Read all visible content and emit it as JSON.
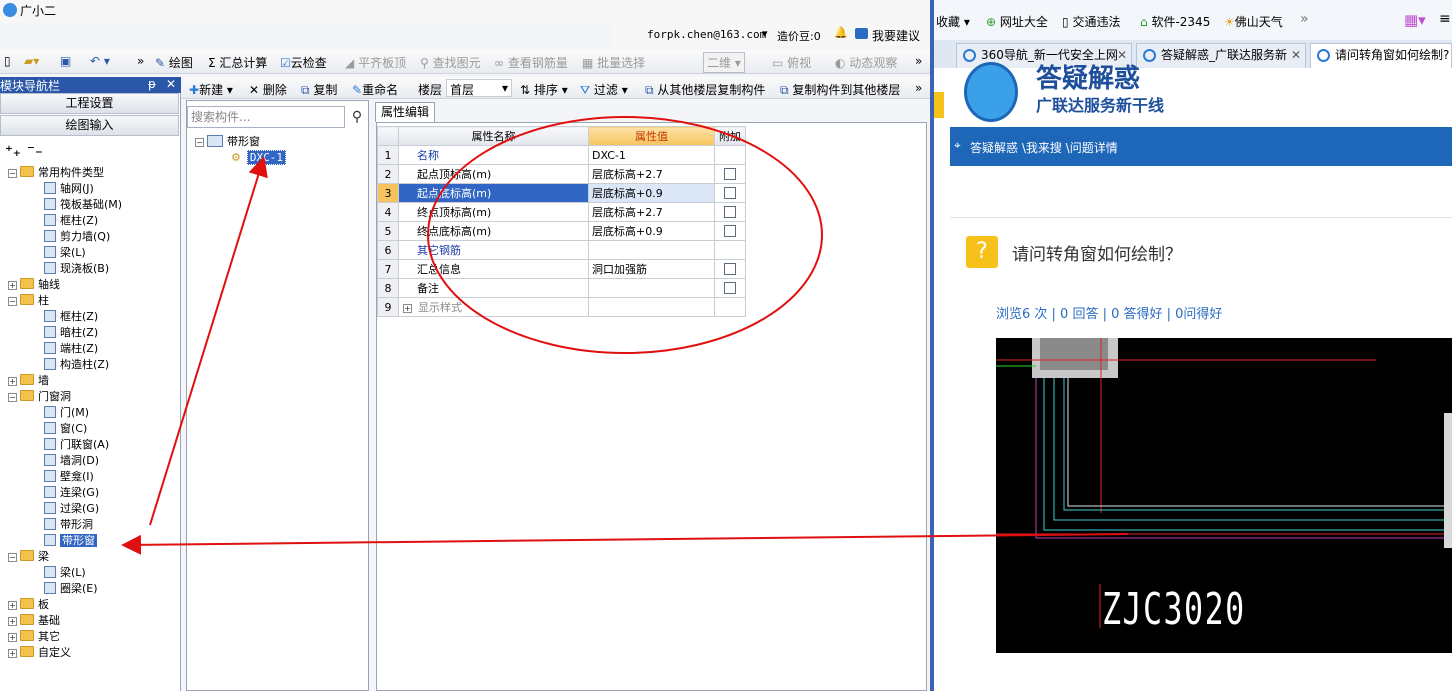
{
  "app": {
    "title": "广小二",
    "account": "forpk.chen@163.com",
    "price_beans": "造价豆:0",
    "suggest": "我要建议",
    "toolbar1": [
      {
        "label": "绘图",
        "enabled": true
      },
      {
        "label": "汇总计算",
        "enabled": true
      },
      {
        "label": "云检查",
        "enabled": true
      },
      {
        "label": "平齐板顶",
        "enabled": false
      },
      {
        "label": "查找图元",
        "enabled": false
      },
      {
        "label": "查看钢筋量",
        "enabled": false
      },
      {
        "label": "批量选择",
        "enabled": false
      },
      {
        "label": "二维",
        "enabled": false
      },
      {
        "label": "俯视",
        "enabled": false
      },
      {
        "label": "动态观察",
        "enabled": false
      }
    ],
    "nav": {
      "header": "模块导航栏",
      "pin": "ᵽ",
      "close": "✕",
      "buttons": [
        "工程设置",
        "绘图输入"
      ],
      "tree": [
        {
          "label": "常用构件类型",
          "level": 0,
          "type": "folder",
          "expanded": true
        },
        {
          "label": "轴网(J)",
          "level": 1,
          "type": "item"
        },
        {
          "label": "筏板基础(M)",
          "level": 1,
          "type": "item"
        },
        {
          "label": "框柱(Z)",
          "level": 1,
          "type": "item"
        },
        {
          "label": "剪力墙(Q)",
          "level": 1,
          "type": "item"
        },
        {
          "label": "梁(L)",
          "level": 1,
          "type": "item"
        },
        {
          "label": "现浇板(B)",
          "level": 1,
          "type": "item"
        },
        {
          "label": "轴线",
          "level": 0,
          "type": "folder",
          "expanded": false
        },
        {
          "label": "柱",
          "level": 0,
          "type": "folder",
          "expanded": true
        },
        {
          "label": "框柱(Z)",
          "level": 1,
          "type": "item"
        },
        {
          "label": "暗柱(Z)",
          "level": 1,
          "type": "item"
        },
        {
          "label": "端柱(Z)",
          "level": 1,
          "type": "item"
        },
        {
          "label": "构造柱(Z)",
          "level": 1,
          "type": "item"
        },
        {
          "label": "墙",
          "level": 0,
          "type": "folder",
          "expanded": false
        },
        {
          "label": "门窗洞",
          "level": 0,
          "type": "folder",
          "expanded": true
        },
        {
          "label": "门(M)",
          "level": 1,
          "type": "item"
        },
        {
          "label": "窗(C)",
          "level": 1,
          "type": "item"
        },
        {
          "label": "门联窗(A)",
          "level": 1,
          "type": "item"
        },
        {
          "label": "墙洞(D)",
          "level": 1,
          "type": "item"
        },
        {
          "label": "壁龛(I)",
          "level": 1,
          "type": "item"
        },
        {
          "label": "连梁(G)",
          "level": 1,
          "type": "item"
        },
        {
          "label": "过梁(G)",
          "level": 1,
          "type": "item"
        },
        {
          "label": "带形洞",
          "level": 1,
          "type": "item"
        },
        {
          "label": "带形窗",
          "level": 1,
          "type": "item",
          "selected": true
        },
        {
          "label": "梁",
          "level": 0,
          "type": "folder",
          "expanded": true
        },
        {
          "label": "梁(L)",
          "level": 1,
          "type": "item"
        },
        {
          "label": "圈梁(E)",
          "level": 1,
          "type": "item"
        },
        {
          "label": "板",
          "level": 0,
          "type": "folder",
          "expanded": false
        },
        {
          "label": "基础",
          "level": 0,
          "type": "folder",
          "expanded": false
        },
        {
          "label": "其它",
          "level": 0,
          "type": "folder",
          "expanded": false
        },
        {
          "label": "自定义",
          "level": 0,
          "type": "folder",
          "expanded": false
        }
      ]
    },
    "toolbar2": {
      "new": "新建",
      "delete": "删除",
      "copy": "复制",
      "rename": "重命名",
      "floor_label": "楼层",
      "floor_value": "首层",
      "sort": "排序",
      "filter": "过滤",
      "copy_from": "从其他楼层复制构件",
      "copy_to": "复制构件到其他楼层"
    },
    "components": {
      "search_placeholder": "搜索构件...",
      "group": "带形窗",
      "item": "DXC-1"
    },
    "property": {
      "tab": "属性编辑",
      "headers": [
        "属性名称",
        "属性值",
        "附加"
      ],
      "rows": [
        {
          "n": "1",
          "name": "名称",
          "value": "DXC-1",
          "check": false,
          "style": "blue"
        },
        {
          "n": "2",
          "name": "起点顶标高(m)",
          "value": "层底标高+2.7",
          "check": true,
          "style": "black"
        },
        {
          "n": "3",
          "name": "起点底标高(m)",
          "value": "层底标高+0.9",
          "check": true,
          "style": "black",
          "selected": true
        },
        {
          "n": "4",
          "name": "终点顶标高(m)",
          "value": "层底标高+2.7",
          "check": true,
          "style": "black"
        },
        {
          "n": "5",
          "name": "终点底标高(m)",
          "value": "层底标高+0.9",
          "check": true,
          "style": "black"
        },
        {
          "n": "6",
          "name": "其它钢筋",
          "value": "",
          "check": false,
          "style": "blue"
        },
        {
          "n": "7",
          "name": "汇总信息",
          "value": "洞口加强筋",
          "check": true,
          "style": "black"
        },
        {
          "n": "8",
          "name": "备注",
          "value": "",
          "check": true,
          "style": "black"
        },
        {
          "n": "9",
          "name": "显示样式",
          "value": "",
          "check": false,
          "style": "gray",
          "expandable": true
        }
      ]
    }
  },
  "browser": {
    "bookmarks": [
      "收藏",
      "网址大全",
      "交通违法",
      "软件-2345",
      "佛山天气"
    ],
    "tabs": [
      {
        "label": "360导航_新一代安全上网",
        "active": false
      },
      {
        "label": "答疑解惑_广联达服务新",
        "active": false
      },
      {
        "label": "请问转角窗如何绘制?",
        "active": true
      }
    ],
    "site_title": "答疑解惑",
    "site_subtitle": "广联达服务新干线",
    "breadcrumb": "答疑解惑 \\我来搜 \\问题详情",
    "question": "请问转角窗如何绘制？",
    "stats": "浏览6 次 | 0 回答 | 0 答得好 | 0问得好",
    "cad_label": "ZJC3020"
  },
  "colors": {
    "nav_header": "#2a57a8",
    "selected": "#3166c4",
    "annotation": "#e01010",
    "site_blue": "#1e66b8"
  }
}
